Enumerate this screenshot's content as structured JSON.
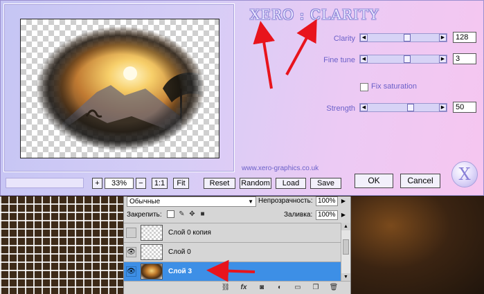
{
  "plugin": {
    "brand": "XERO : CLARITY",
    "website": "www.xero-graphics.co.uk",
    "logo_glyph": "X",
    "params": [
      {
        "label": "Clarity",
        "value": "128",
        "fraction": 0.55
      },
      {
        "label": "Fine tune",
        "value": "3",
        "fraction": 0.55
      },
      {
        "label": "Strength",
        "value": "50",
        "fraction": 0.6
      }
    ],
    "fix_saturation": {
      "label": "Fix saturation",
      "checked": false
    },
    "zoom": {
      "plus": "+",
      "value": "33%",
      "minus": "−",
      "one_to_one": "1:1",
      "fit": "Fit"
    },
    "buttons": {
      "reset": "Reset",
      "random": "Random",
      "load": "Load",
      "save": "Save",
      "ok": "OK",
      "cancel": "Cancel"
    }
  },
  "layers_panel": {
    "blend_mode": "Обычные",
    "opacity_label": "Непрозрачность:",
    "opacity_value": "100%",
    "lock_label": "Закрепить:",
    "fill_label": "Заливка:",
    "fill_value": "100%",
    "layers": [
      {
        "name": "Слой 0 копия",
        "visible": false,
        "selected": false,
        "thumb": "transparent"
      },
      {
        "name": "Слой 0",
        "visible": true,
        "selected": false,
        "thumb": "transparent"
      },
      {
        "name": "Слой 3",
        "visible": true,
        "selected": true,
        "thumb": "photo"
      }
    ],
    "footer_icons": [
      "link-icon",
      "fx-icon",
      "mask-icon",
      "adjustment-icon",
      "folder-icon",
      "new-layer-icon",
      "trash-icon"
    ]
  },
  "colors": {
    "accent_label": "#6a5fc8",
    "selection": "#3d8fe6",
    "annotation_arrow": "#e8141c"
  }
}
